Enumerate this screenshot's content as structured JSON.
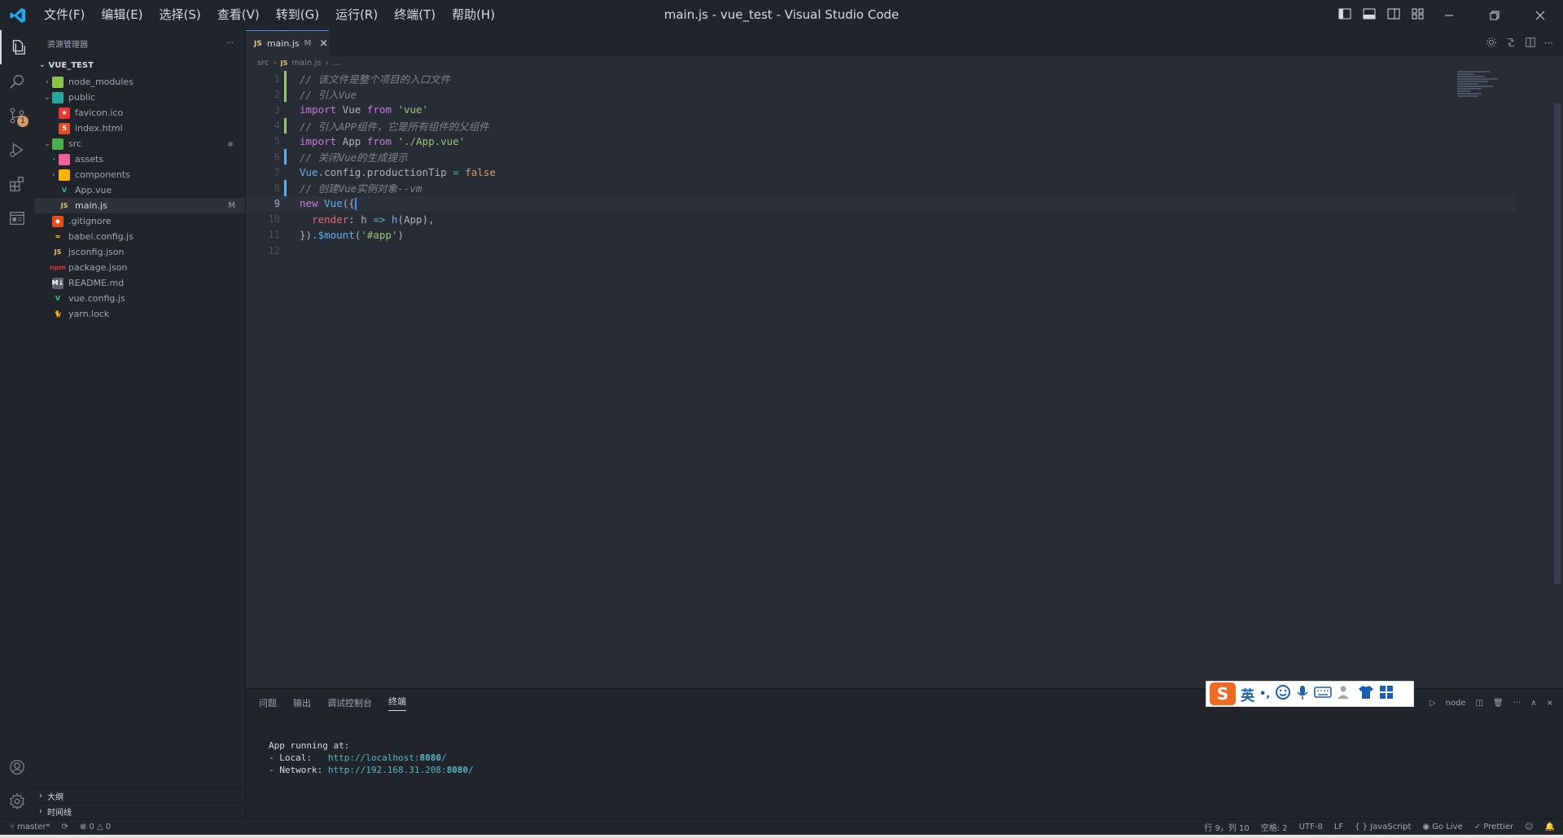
{
  "app": {
    "window_title": "main.js - vue_test - Visual Studio Code",
    "menu": [
      "文件(F)",
      "编辑(E)",
      "选择(S)",
      "查看(V)",
      "转到(G)",
      "运行(R)",
      "终端(T)",
      "帮助(H)"
    ]
  },
  "activity": {
    "scm_badge": "1"
  },
  "sidebar": {
    "title": "资源管理器",
    "project": "VUE_TEST",
    "tree": [
      {
        "label": "node_modules",
        "icon": "folder-node-icon",
        "level": 1,
        "chevron": "›",
        "flag": "",
        "dot": false
      },
      {
        "label": "public",
        "icon": "folder-public-icon",
        "level": 1,
        "chevron": "⌄",
        "flag": "",
        "dot": false
      },
      {
        "label": "favicon.ico",
        "icon": "star-file-icon",
        "level": 2,
        "chevron": "",
        "flag": "",
        "dot": false
      },
      {
        "label": "index.html",
        "icon": "html5-file-icon",
        "level": 2,
        "chevron": "",
        "flag": "",
        "dot": false
      },
      {
        "label": "src",
        "icon": "folder-src-icon",
        "level": 1,
        "chevron": "⌄",
        "flag": "",
        "dot": true
      },
      {
        "label": "assets",
        "icon": "folder-assets-icon",
        "level": 2,
        "chevron": "›",
        "flag": "",
        "dot": false
      },
      {
        "label": "components",
        "icon": "folder-components-icon",
        "level": 2,
        "chevron": "›",
        "flag": "",
        "dot": false
      },
      {
        "label": "App.vue",
        "icon": "vue-file-icon",
        "level": 2,
        "chevron": "",
        "flag": "",
        "dot": false
      },
      {
        "label": "main.js",
        "icon": "js-file-icon",
        "level": 2,
        "chevron": "",
        "flag": "M",
        "dot": false,
        "selected": true
      },
      {
        "label": ".gitignore",
        "icon": "git-file-icon",
        "level": 1,
        "chevron": "",
        "flag": "",
        "dot": false
      },
      {
        "label": "babel.config.js",
        "icon": "babel-file-icon",
        "level": 1,
        "chevron": "",
        "flag": "",
        "dot": false
      },
      {
        "label": "jsconfig.json",
        "icon": "js-file-icon",
        "level": 1,
        "chevron": "",
        "flag": "",
        "dot": false
      },
      {
        "label": "package.json",
        "icon": "npm-file-icon",
        "level": 1,
        "chevron": "",
        "flag": "",
        "dot": false
      },
      {
        "label": "README.md",
        "icon": "markdown-file-icon",
        "level": 1,
        "chevron": "",
        "flag": "",
        "dot": false
      },
      {
        "label": "vue.config.js",
        "icon": "vue-config-file-icon",
        "level": 1,
        "chevron": "",
        "flag": "",
        "dot": false
      },
      {
        "label": "yarn.lock",
        "icon": "yarn-file-icon",
        "level": 1,
        "chevron": "",
        "flag": "",
        "dot": false
      }
    ],
    "outline_label": "大纲",
    "timeline_label": "时间线"
  },
  "editor": {
    "tab": {
      "label": "main.js",
      "type": "JS",
      "flag": "M"
    },
    "breadcrumb": [
      "src",
      "main.js",
      "..."
    ],
    "current_line": 9,
    "lines": [
      {
        "n": "1",
        "mod": "added",
        "tokens": [
          {
            "c": "cmt",
            "t": "// 该文件是整个项目的入口文件"
          }
        ]
      },
      {
        "n": "2",
        "mod": "added",
        "tokens": [
          {
            "c": "cmt",
            "t": "// 引入Vue"
          }
        ]
      },
      {
        "n": "3",
        "mod": "",
        "tokens": [
          {
            "c": "imp",
            "t": "import"
          },
          {
            "c": "pl",
            "t": " Vue "
          },
          {
            "c": "imp",
            "t": "from"
          },
          {
            "c": "pl",
            "t": " "
          },
          {
            "c": "str",
            "t": "'vue'"
          }
        ]
      },
      {
        "n": "4",
        "mod": "added",
        "tokens": [
          {
            "c": "cmt",
            "t": "// 引入APP组件，它是所有组件的父组件"
          }
        ]
      },
      {
        "n": "5",
        "mod": "",
        "tokens": [
          {
            "c": "imp",
            "t": "import"
          },
          {
            "c": "pl",
            "t": " App "
          },
          {
            "c": "imp",
            "t": "from"
          },
          {
            "c": "pl",
            "t": " "
          },
          {
            "c": "str",
            "t": "'./App.vue'"
          }
        ]
      },
      {
        "n": "6",
        "mod": "modified",
        "tokens": [
          {
            "c": "cmt",
            "t": "// 关闭Vue的生成提示"
          }
        ]
      },
      {
        "n": "7",
        "mod": "",
        "tokens": [
          {
            "c": "fn",
            "t": "Vue"
          },
          {
            "c": "pl",
            "t": ".config.productionTip "
          },
          {
            "c": "op",
            "t": "="
          },
          {
            "c": "pl",
            "t": " "
          },
          {
            "c": "bool",
            "t": "false"
          }
        ]
      },
      {
        "n": "8",
        "mod": "modified",
        "tokens": [
          {
            "c": "cmt",
            "t": "// 创建Vue实例对象--vm"
          }
        ]
      },
      {
        "n": "9",
        "mod": "",
        "tokens": [
          {
            "c": "kw",
            "t": "new"
          },
          {
            "c": "pl",
            "t": " "
          },
          {
            "c": "fn",
            "t": "Vue"
          },
          {
            "c": "pl",
            "t": "({"
          }
        ]
      },
      {
        "n": "10",
        "mod": "",
        "tokens": [
          {
            "c": "pl",
            "t": "  "
          },
          {
            "c": "prop",
            "t": "render"
          },
          {
            "c": "pl",
            "t": ": h "
          },
          {
            "c": "op",
            "t": "=>"
          },
          {
            "c": "pl",
            "t": " "
          },
          {
            "c": "fn",
            "t": "h"
          },
          {
            "c": "pl",
            "t": "(App),"
          }
        ]
      },
      {
        "n": "11",
        "mod": "",
        "tokens": [
          {
            "c": "pl",
            "t": "})."
          },
          {
            "c": "fn",
            "t": "$mount"
          },
          {
            "c": "pl",
            "t": "("
          },
          {
            "c": "str",
            "t": "'#app'"
          },
          {
            "c": "pl",
            "t": ")"
          }
        ]
      },
      {
        "n": "12",
        "mod": "",
        "tokens": []
      }
    ]
  },
  "panel": {
    "tabs": [
      "问题",
      "输出",
      "调试控制台",
      "终端"
    ],
    "active_tab": "终端",
    "shell": "node",
    "terminal": {
      "line1": "App running at:",
      "local_label": "- Local:   ",
      "local_url": "http://localhost:",
      "local_port": "8080",
      "local_tail": "/",
      "net_label": "- Network: ",
      "net_url": "http://192.168.31.208:",
      "net_port": "8080",
      "net_tail": "/"
    }
  },
  "ime": {
    "mode": "英",
    "punct": "•,"
  },
  "statusbar": {
    "branch": "master*",
    "errors": "0",
    "warnings": "0",
    "position": "行 9，列 10",
    "spaces": "空格: 2",
    "encoding": "UTF-8",
    "eol": "LF",
    "language": "JavaScript",
    "golive": "Go Live",
    "prettier": "Prettier"
  },
  "colors": {
    "accent": "#528bff",
    "added": "#98c379",
    "modified": "#61afef",
    "ime_orange": "#ee6b24"
  }
}
